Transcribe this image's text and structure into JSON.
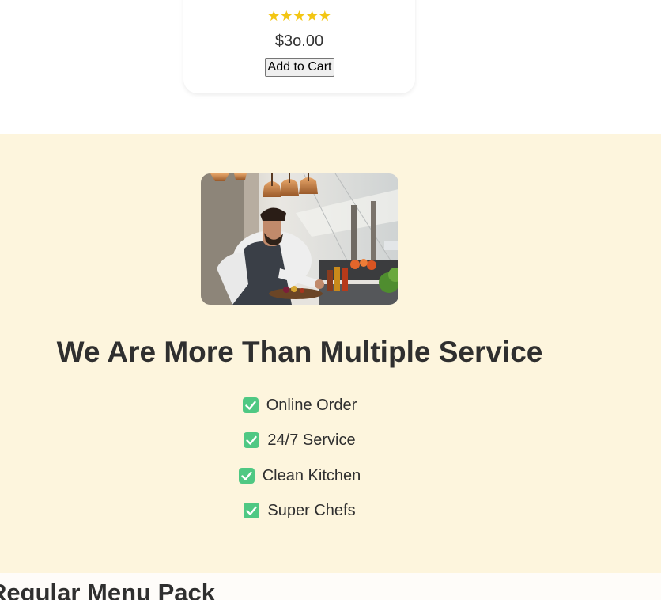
{
  "product": {
    "stars": "★★★★★",
    "rating": 5,
    "price": "$3o.00",
    "add_to_cart_label": "Add to Cart"
  },
  "services": {
    "title": "We Are More Than Multiple Service",
    "items": [
      {
        "label": "Online Order",
        "icon": "check-box-icon"
      },
      {
        "label": "24/7 Service",
        "icon": "check-box-icon"
      },
      {
        "label": "Clean Kitchen",
        "icon": "check-box-icon"
      },
      {
        "label": "Super Chefs",
        "icon": "check-box-icon"
      }
    ]
  },
  "regular_menu": {
    "title": "Regular Menu Pack"
  },
  "colors": {
    "star": "#f3c614",
    "section_background": "#fdf5dd",
    "check_green": "#4fc883",
    "heading_text": "#2f2f2f"
  }
}
